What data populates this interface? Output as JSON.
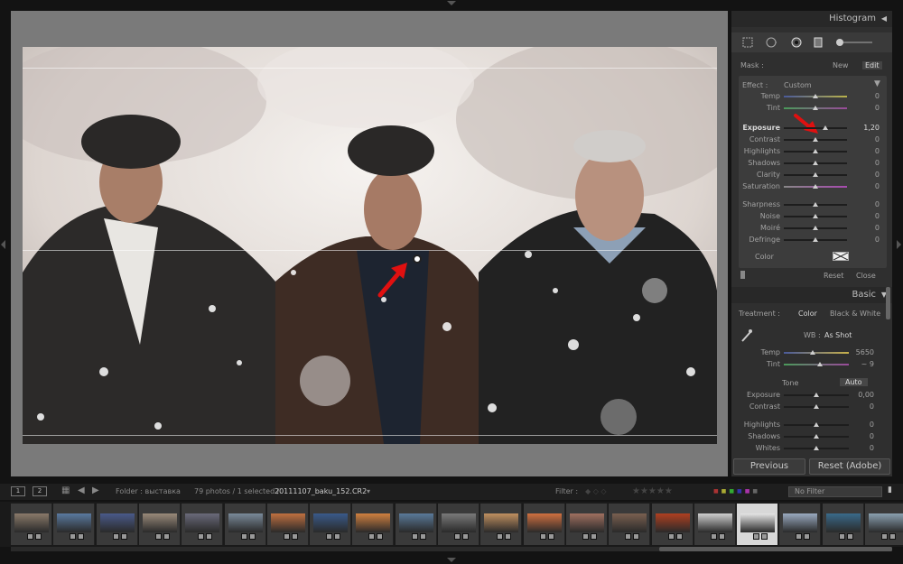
{
  "histogram": {
    "title": "Histogram"
  },
  "tools": [
    "crop-tool-icon",
    "spot-removal-icon",
    "red-eye-icon",
    "graduated-filter-icon",
    "adjustment-brush-icon"
  ],
  "mask": {
    "label": "Mask :",
    "new": "New",
    "edit": "Edit"
  },
  "effect": {
    "label": "Effect :",
    "value": "Custom"
  },
  "mask_sliders_top": [
    {
      "label": "Temp",
      "value": "0",
      "pos": 0.5
    },
    {
      "label": "Tint",
      "value": "0",
      "pos": 0.5
    }
  ],
  "mask_sliders_mid": [
    {
      "label": "Exposure",
      "value": "1,20",
      "pos": 0.65
    },
    {
      "label": "Contrast",
      "value": "0",
      "pos": 0.5
    },
    {
      "label": "Highlights",
      "value": "0",
      "pos": 0.5
    },
    {
      "label": "Shadows",
      "value": "0",
      "pos": 0.5
    },
    {
      "label": "Clarity",
      "value": "0",
      "pos": 0.5
    },
    {
      "label": "Saturation",
      "value": "0",
      "pos": 0.5
    }
  ],
  "mask_sliders_bottom": [
    {
      "label": "Sharpness",
      "value": "0",
      "pos": 0.5
    },
    {
      "label": "Noise",
      "value": "0",
      "pos": 0.5
    },
    {
      "label": "Moiré",
      "value": "0",
      "pos": 0.5
    },
    {
      "label": "Defringe",
      "value": "0",
      "pos": 0.5
    }
  ],
  "color": {
    "label": "Color"
  },
  "mask_footer": {
    "reset": "Reset",
    "close": "Close"
  },
  "basic": {
    "title": "Basic",
    "treatment_label": "Treatment :",
    "color": "Color",
    "bw": "Black & White",
    "wb_label": "WB :",
    "wb_value": "As Shot",
    "temp": {
      "label": "Temp",
      "value": "5650",
      "pos": 0.45
    },
    "tint": {
      "label": "Tint",
      "value": "~ 9",
      "pos": 0.55
    },
    "tone_label": "Tone",
    "auto": "Auto",
    "exposure": {
      "label": "Exposure",
      "value": "0,00",
      "pos": 0.5
    },
    "contrast": {
      "label": "Contrast",
      "value": "0",
      "pos": 0.5
    },
    "highlights": {
      "label": "Highlights",
      "value": "0",
      "pos": 0.5
    },
    "shadows": {
      "label": "Shadows",
      "value": "0",
      "pos": 0.5
    },
    "whites": {
      "label": "Whites",
      "value": "0",
      "pos": 0.5
    }
  },
  "buttons": {
    "previous": "Previous",
    "reset": "Reset (Adobe)"
  },
  "filmbar": {
    "page1": "1",
    "page2": "2",
    "folder": "Folder : выставка",
    "count": "79 photos / 1 selected /",
    "file": "20111107_baku_152.CR2",
    "filter": "Filter :",
    "no_filter": "No Filter"
  },
  "colors": {
    "panel": "#2f2f2f",
    "canvas": "#7a7a7a",
    "accent_red": "#e01010"
  }
}
